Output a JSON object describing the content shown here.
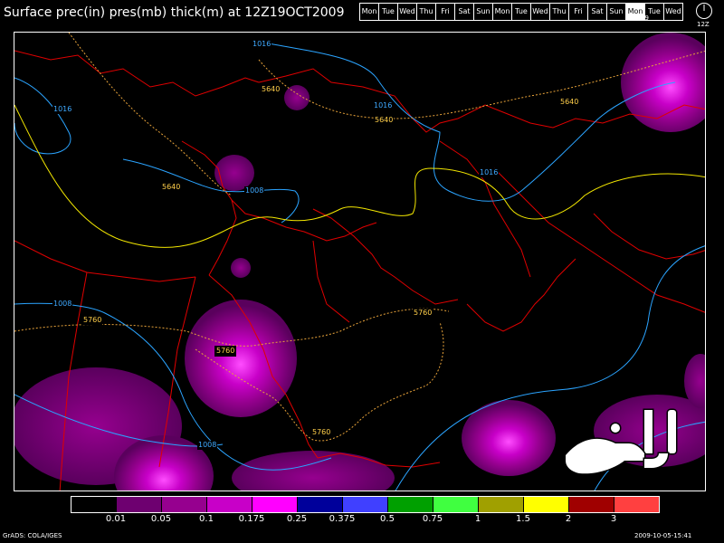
{
  "title": "Surface prec(in) pres(mb) thick(m) at 12Z19OCT2009",
  "days": [
    "Mon",
    "Tue",
    "Wed",
    "Thu",
    "Fri",
    "Sat",
    "Sun",
    "Mon",
    "Tue",
    "Wed",
    "Thu",
    "Fri",
    "Sat",
    "Sun",
    "Mon",
    "Tue",
    "Wed"
  ],
  "current_day_index": 14,
  "current_day_number": "19",
  "clock_label": "12Z",
  "contour_labels": {
    "p1016_nw": "1016",
    "p1016_w": "1016",
    "p1016_c": "1016",
    "p1016_e": "1016",
    "p1008_c": "1008",
    "p1008_w": "1008",
    "p1008_s": "1008",
    "t5640_a": "5640",
    "t5640_b": "5640",
    "t5640_c": "5640",
    "t5640_d": "5640",
    "t5760_a": "5760",
    "t5760_b": "5760",
    "t5760_c": "5760",
    "t5760_d": "5760"
  },
  "colorbar": {
    "colors": [
      "#000000",
      "#6e0070",
      "#96008f",
      "#c800c8",
      "#ff00ff",
      "#00009b",
      "#4040ff",
      "#00a000",
      "#40ff40",
      "#a0a000",
      "#ffff00",
      "#a00000",
      "#ff4040"
    ],
    "ticks": [
      "0.01",
      "0.05",
      "0.1",
      "0.175",
      "0.25",
      "0.375",
      "0.5",
      "0.75",
      "1",
      "1.5",
      "2",
      "3"
    ]
  },
  "footer_left": "GrADS: COLA/IGES",
  "footer_right": "2009-10-05-15:41"
}
